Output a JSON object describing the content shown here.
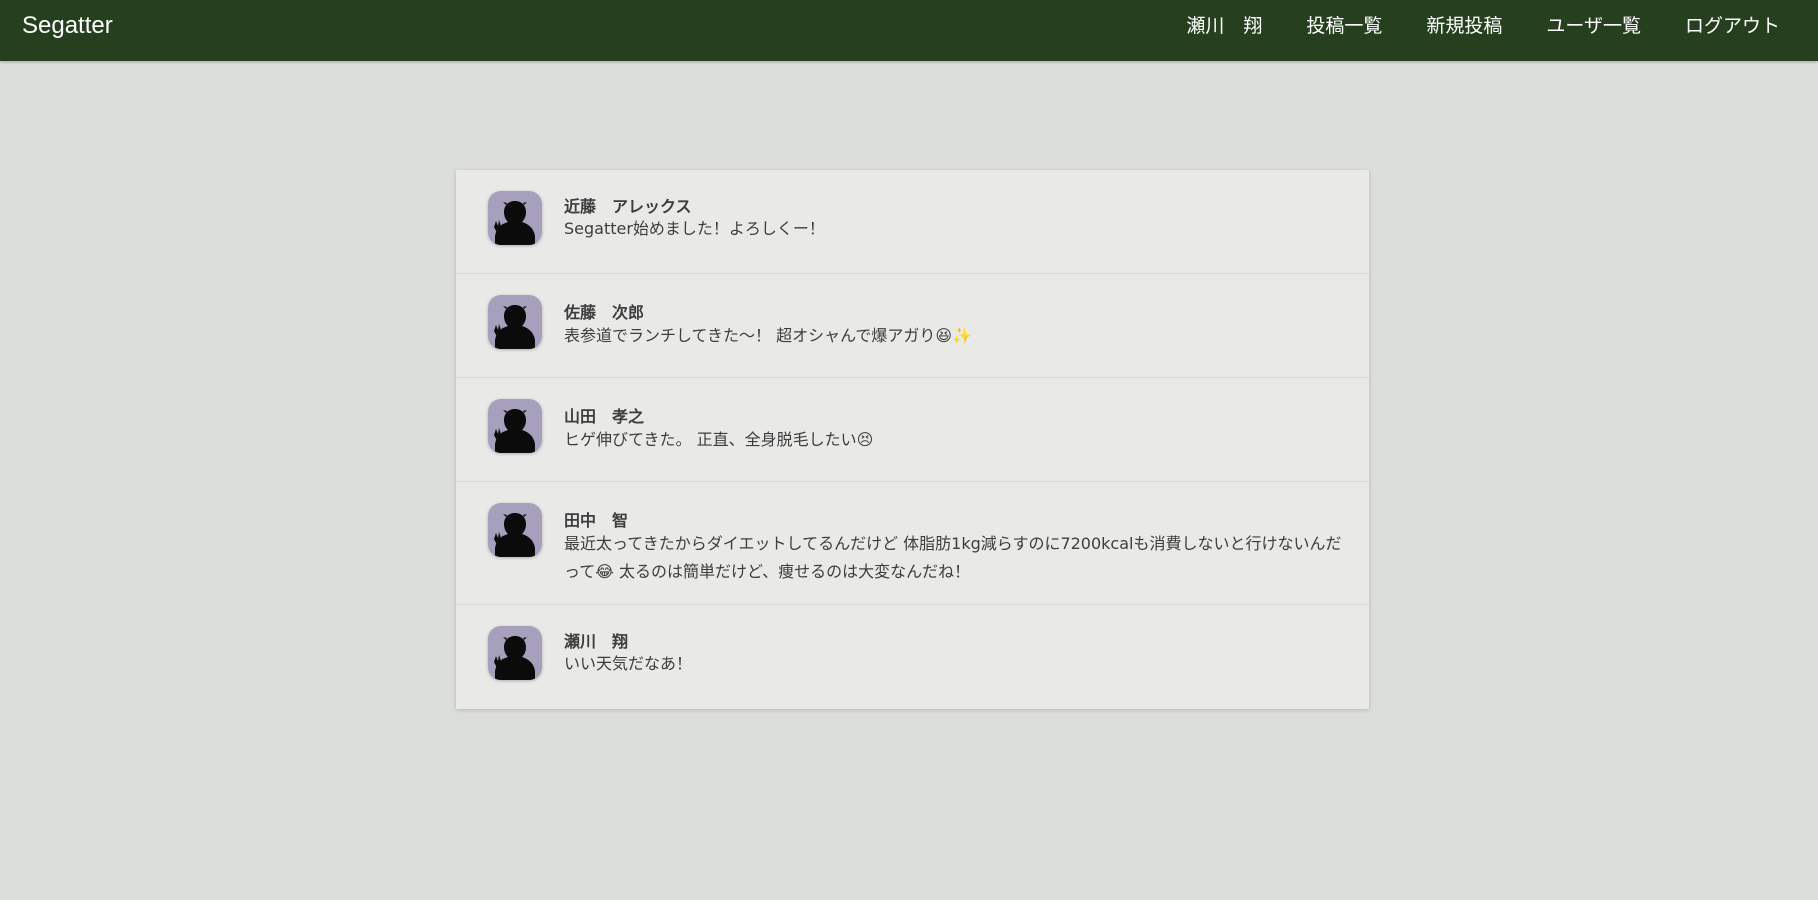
{
  "header": {
    "brand": "Segatter",
    "nav": {
      "current_user": "瀬川　翔",
      "posts_index": "投稿一覧",
      "new_post": "新規投稿",
      "users_index": "ユーザ一覧",
      "logout": "ログアウト"
    }
  },
  "colors": {
    "header_bg": "#26401f",
    "page_bg": "#dcdedb",
    "card_bg": "#e9eae7",
    "avatar_bg": "#a7a0bd"
  },
  "posts": [
    {
      "user": "近藤　アレックス",
      "content": "Segatter始めました！よろしくー！"
    },
    {
      "user": "佐藤　次郎",
      "content": "表参道でランチしてきた〜！ 超オシャんで爆アガり😆✨"
    },
    {
      "user": "山田　孝之",
      "content": "ヒゲ伸びてきた。 正直、全身脱毛したい😣"
    },
    {
      "user": "田中　智",
      "content": "最近太ってきたからダイエットしてるんだけど 体脂肪1kg減らすのに7200kcalも消費しないと行けないんだって😂 太るのは簡単だけど、痩せるのは大変なんだね！"
    },
    {
      "user": "瀬川　翔",
      "content": "いい天気だなあ！"
    }
  ]
}
